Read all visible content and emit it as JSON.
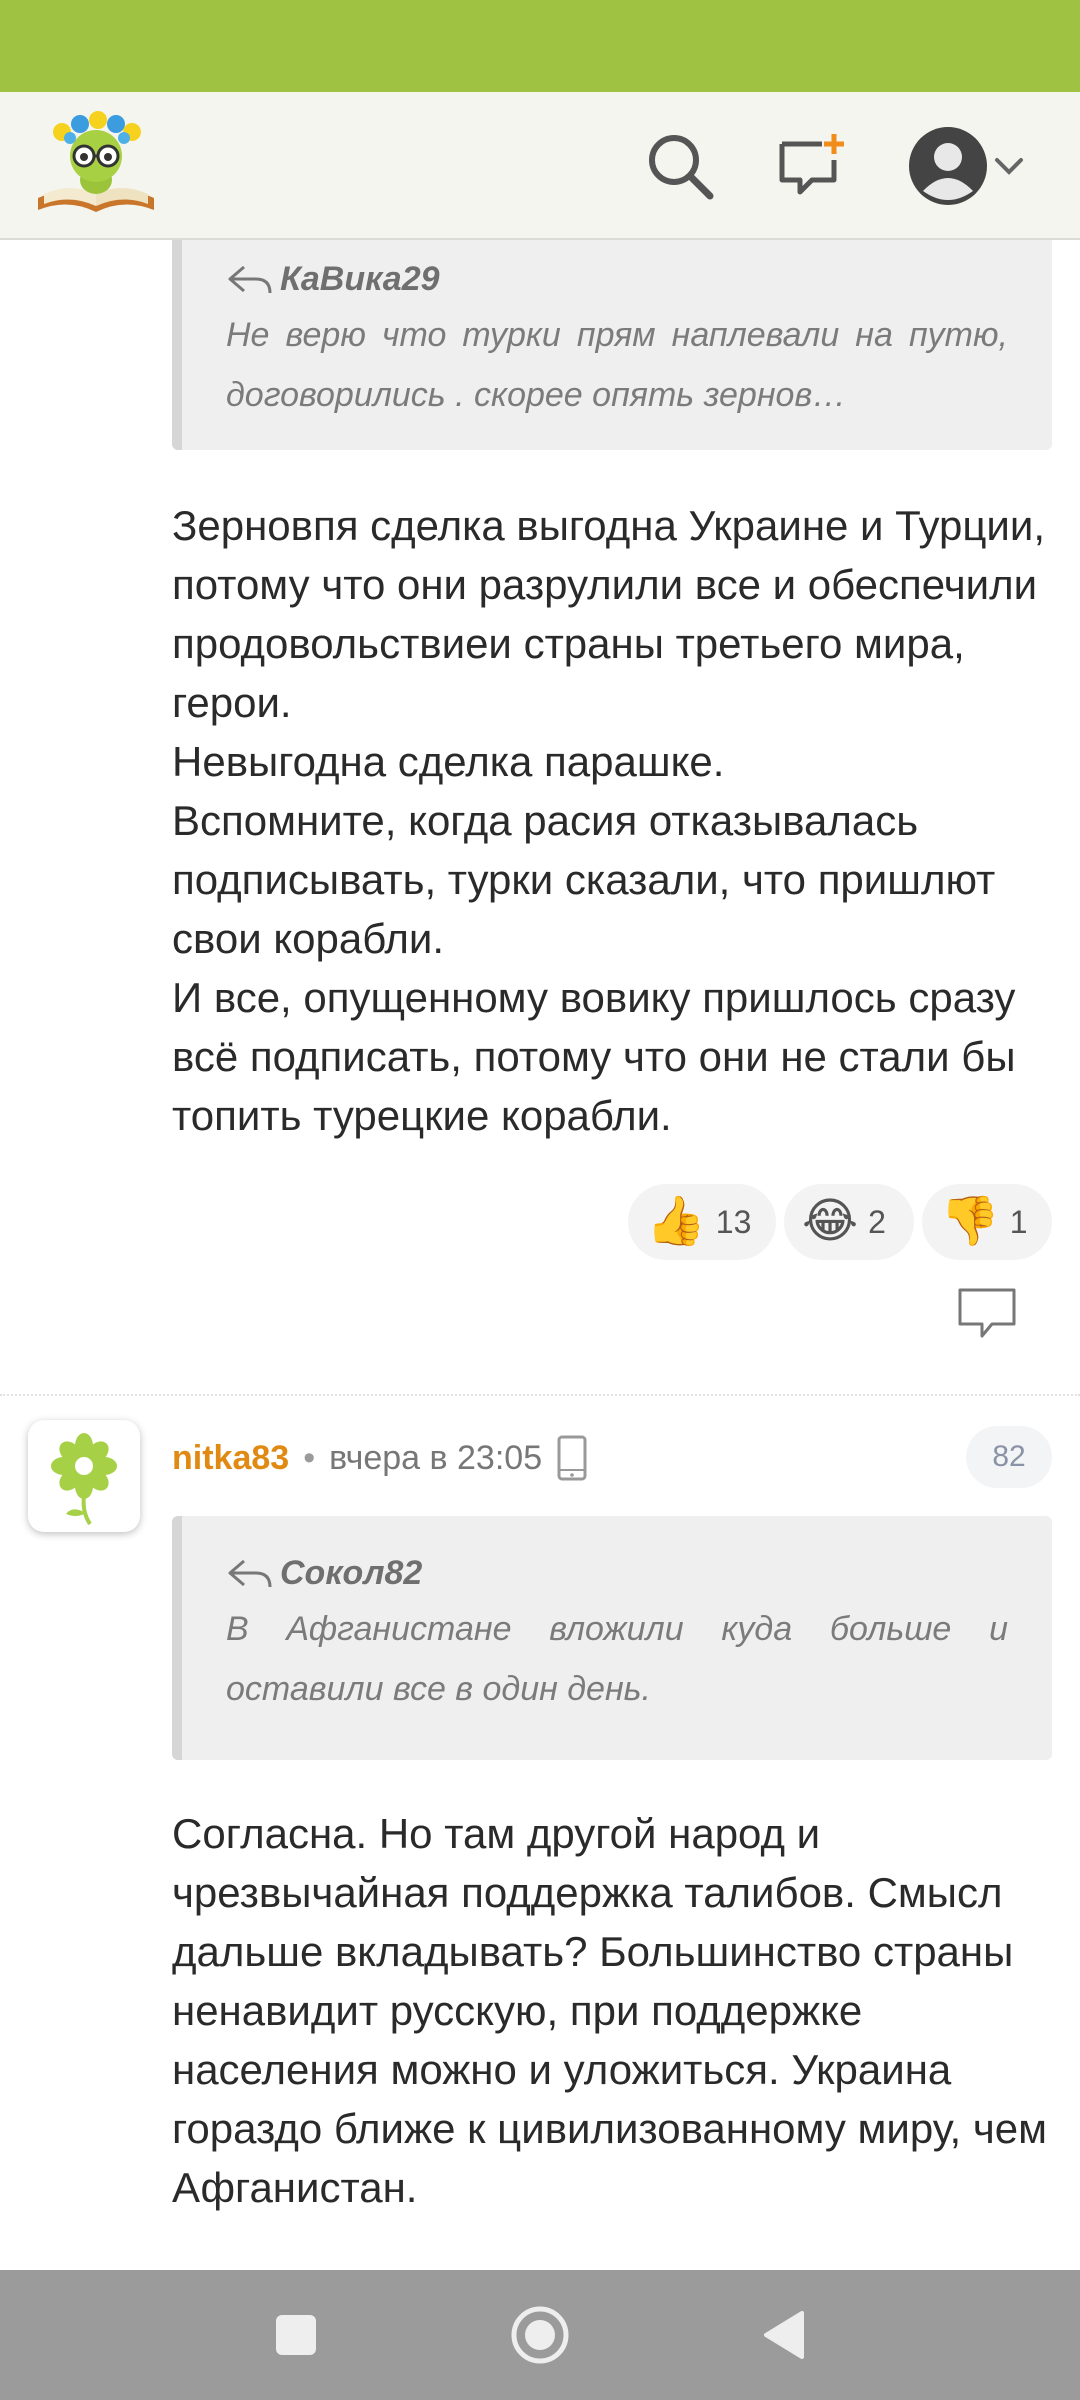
{
  "colors": {
    "status_bar": "#9fc243",
    "username": "#e08a13",
    "header_bg": "#f5f5f0",
    "quote_bg": "#efefef",
    "nav_bar": "#9b9b9b"
  },
  "header": {
    "icons": [
      "logo-icon",
      "search-icon",
      "new-message-icon",
      "avatar-icon",
      "chevron-down-icon"
    ]
  },
  "comments": [
    {
      "quote": {
        "author": "КаВика29",
        "text": "Не верю что турки прям наплевали на путю, договорились . скорее опять зернов…"
      },
      "paragraphs": [
        "Зерновпя сделка выгодна Украине и Турции, потому что они разрулили все и обеспечили продовольствиеи страны третьего мира, герои.",
        "Невыгодна сделка парашке.",
        "Вспомните, когда расия отказывалась подписывать, турки сказали, что пришлют свои корабли.",
        "И все, опущенному вовику пришлось сразу всё подписать, потому что они не стали бы топить турецкие корабли."
      ],
      "reactions": [
        {
          "icon": "thumbs-up-icon",
          "glyph": "👍",
          "count": "13"
        },
        {
          "icon": "laughing-icon",
          "glyph": "😂",
          "count": "2"
        },
        {
          "icon": "thumbs-down-icon",
          "glyph": "👎",
          "count": "1"
        }
      ]
    },
    {
      "username": "nitka83",
      "separator": "•",
      "time": "вчера в 23:05",
      "counter": "82",
      "quote": {
        "author": "Сокол82",
        "text": "В Афганистане вложили куда больше и оставили все в один день."
      },
      "paragraphs": [
        "Согласна. Но там другой народ и чрезвычайная поддержка талибов. Смысл дальше вкладывать? Большинство страны ненавидит русскую, при поддержке населения можно и уложиться. Украина гораздо ближе к цивилизованному миру, чем Афганистан."
      ]
    }
  ]
}
